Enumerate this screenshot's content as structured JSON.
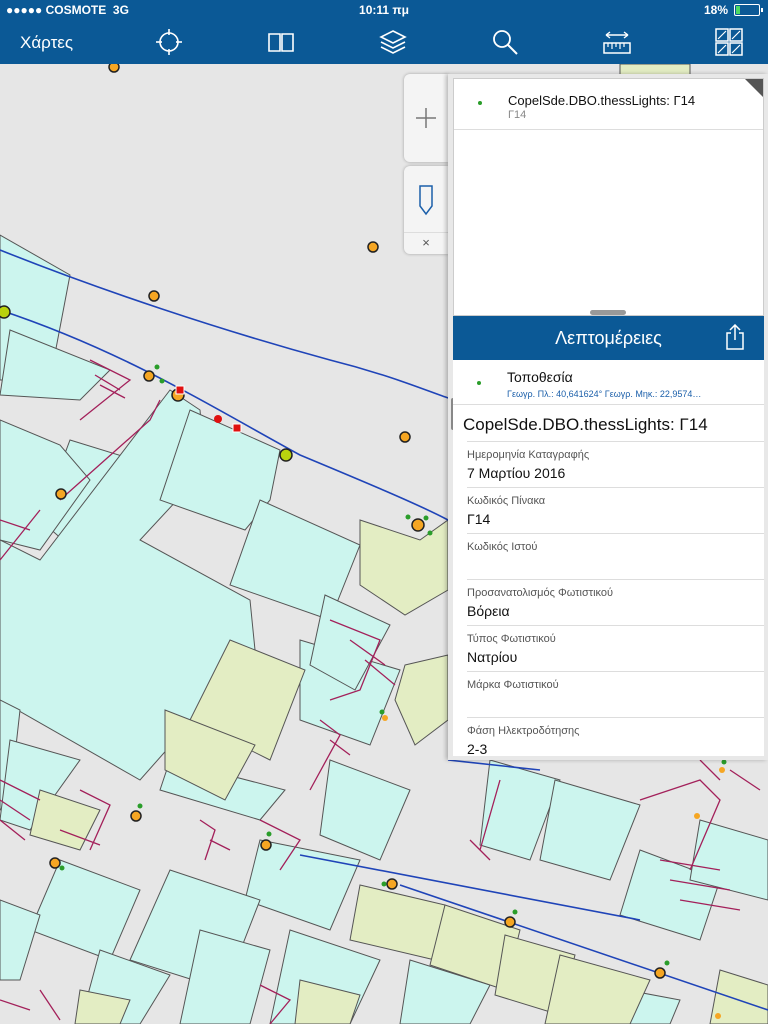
{
  "status": {
    "carrier": "●●●●● COSMOTE",
    "network": "3G",
    "time": "10:11 πμ",
    "battery": "18%",
    "battery_level": 0.18
  },
  "toolbar": {
    "title": "Χάρτες",
    "icons": [
      "locate-icon",
      "bookmarks-icon",
      "layers-icon",
      "search-icon",
      "measure-icon",
      "basemap-gallery-icon"
    ]
  },
  "controls": {
    "zoom_in": "+",
    "dismiss": "×"
  },
  "results": {
    "items": [
      {
        "title": "CopelSde.DBO.thessLights: Γ14",
        "subtitle": "Γ14"
      }
    ]
  },
  "details": {
    "header": "Λεπτομέρειες",
    "location_label": "Τοποθεσία",
    "location_coords": "Γεωγρ. Πλ.: 40,641624° Γεωγρ. Μηκ.: 22,9574…",
    "feature_title": "CopelSde.DBO.thessLights: Γ14",
    "fields": [
      {
        "label": "Ημερομηνία Καταγραφής",
        "value": "7 Μαρτίου 2016"
      },
      {
        "label": "Κωδικός Πίνακα",
        "value": "Γ14"
      },
      {
        "label": "Κωδικός Ιστού",
        "value": ""
      },
      {
        "label": "Προσανατολισμός Φωτιστικού",
        "value": "Βόρεια"
      },
      {
        "label": "Τύπος Φωτιστικού",
        "value": "Νατρίου"
      },
      {
        "label": "Μάρκα Φωτιστικού",
        "value": ""
      },
      {
        "label": "Φάση Ηλεκτροδότησης",
        "value": "2-3"
      }
    ]
  },
  "colors": {
    "brand": "#0b5996",
    "map_bg": "#e6e6e6",
    "building_cyan": "#ccf5ee",
    "building_green": "#e3edc3",
    "road_line": "#1f44b8",
    "parcel_line": "#a3205a",
    "light_point": "#f5a623"
  }
}
